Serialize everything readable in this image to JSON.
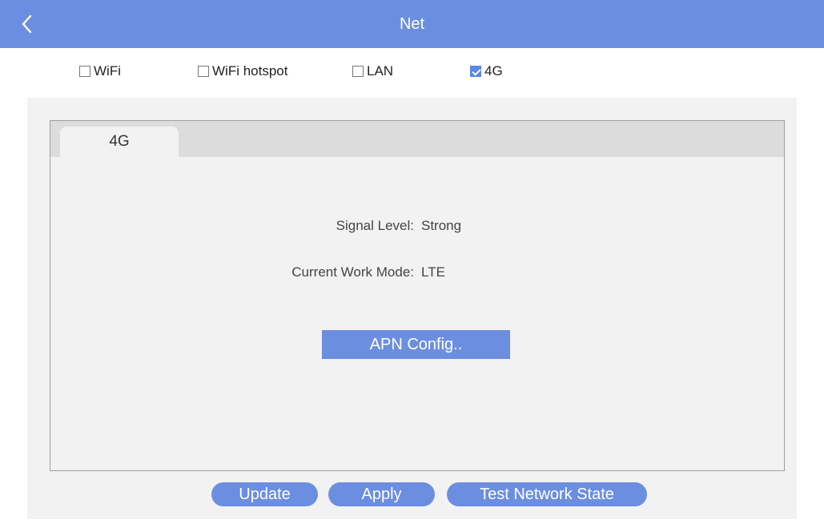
{
  "header": {
    "title": "Net",
    "back_icon": "chevron-left-icon",
    "color": "#6b8ee0"
  },
  "modes": [
    {
      "label": "WiFi",
      "checked": false
    },
    {
      "label": "WiFi hotspot",
      "checked": false
    },
    {
      "label": "LAN",
      "checked": false
    },
    {
      "label": "4G",
      "checked": true
    }
  ],
  "tab": {
    "label": "4G"
  },
  "info": {
    "signal_label": "Signal Level:",
    "signal_value": "Strong",
    "mode_label": "Current Work Mode:",
    "mode_value": "LTE"
  },
  "buttons": {
    "apn": "APN Config..",
    "update": "Update",
    "apply": "Apply",
    "test": "Test Network State"
  }
}
